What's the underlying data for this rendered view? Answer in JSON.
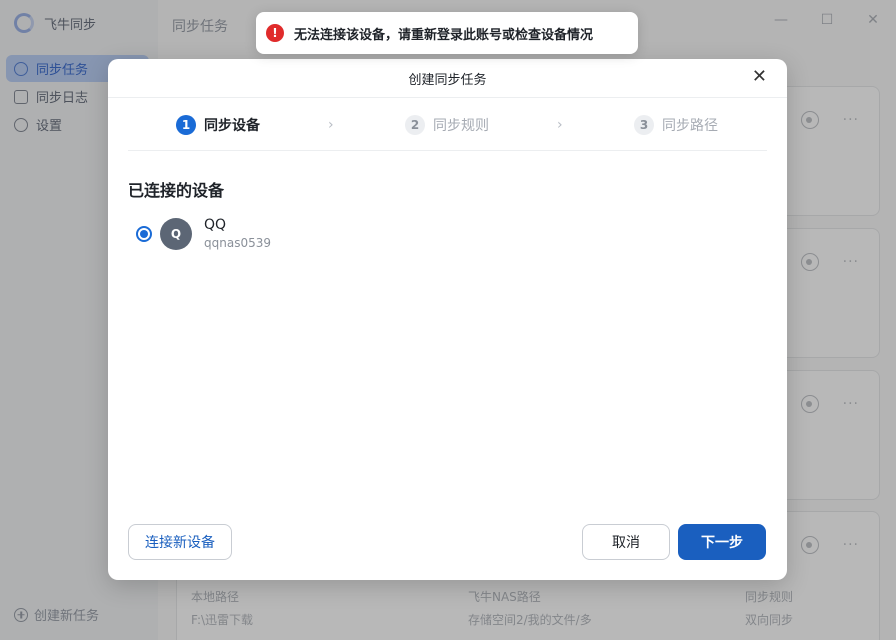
{
  "app": {
    "name": "飞牛同步",
    "sidebar": [
      {
        "label": "同步任务",
        "active": true
      },
      {
        "label": "同步日志",
        "active": false
      },
      {
        "label": "设置",
        "active": false
      }
    ],
    "create_task": "创建新任务",
    "main_title": "同步任务",
    "window_controls": {
      "minimize": "—",
      "maximize": "☐",
      "close": "✕"
    },
    "bottom_card": {
      "local_path_label": "本地路径",
      "local_path": "F:\\迅雷下载",
      "nas_path_label": "飞牛NAS路径",
      "nas_path": "存储空间2/我的文件/多",
      "rule_label": "同步规则",
      "rule": "双向同步"
    },
    "card_more": "···"
  },
  "toast": {
    "icon": "!",
    "text": "无法连接该设备，请重新登录此账号或检查设备情况"
  },
  "dialog": {
    "title": "创建同步任务",
    "close": "✕",
    "steps": [
      {
        "num": "1",
        "label": "同步设备"
      },
      {
        "num": "2",
        "label": "同步规则"
      },
      {
        "num": "3",
        "label": "同步路径"
      }
    ],
    "step_separator": "›",
    "section_title": "已连接的设备",
    "device": {
      "avatar": "Q",
      "name": "QQ",
      "id": "qqnas0539"
    },
    "connect_new": "连接新设备",
    "cancel": "取消",
    "next": "下一步"
  },
  "colors": {
    "primary": "#1a6bd6",
    "error": "#e02b2b"
  }
}
